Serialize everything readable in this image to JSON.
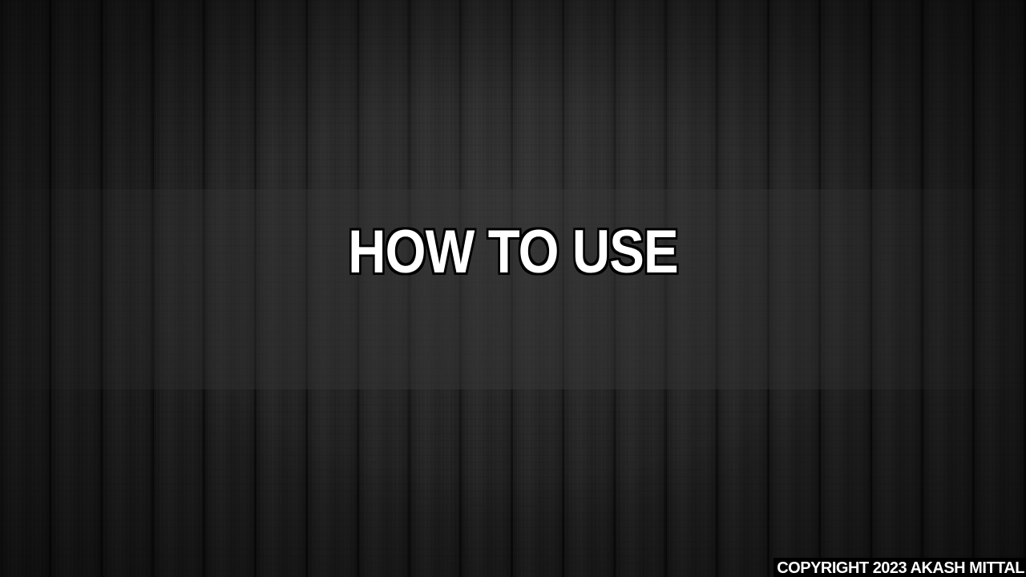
{
  "screen": {
    "title": "HOW TO USE",
    "copyright": "COPYRIGHT 2023 AKASH MITTAL"
  },
  "colors": {
    "background": "#1a1a1a",
    "title_text": "#ffffff",
    "title_outline": "#000000",
    "copyright_bg": "#000000"
  }
}
